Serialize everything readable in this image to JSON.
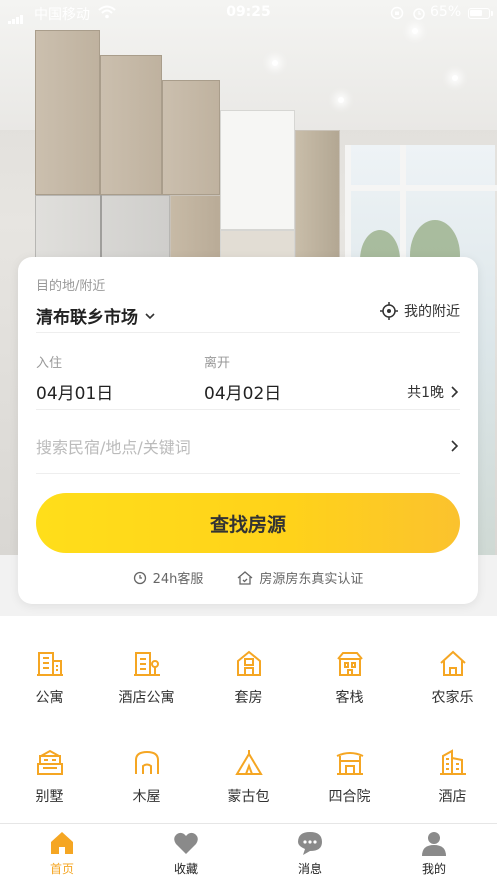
{
  "status_bar": {
    "carrier": "中国移动",
    "time": "09:25",
    "battery": "65%"
  },
  "search": {
    "dest_label": "目的地/附近",
    "dest_value": "清布联乡市场",
    "nearby_label": "我的附近",
    "checkin_label": "入住",
    "checkin_value": "04月01日",
    "checkout_label": "离开",
    "checkout_value": "04月02日",
    "nights": "共1晚",
    "keyword_placeholder": "搜索民宿/地点/关键词",
    "submit_label": "查找房源",
    "service_label": "24h客服",
    "verify_label": "房源房东真实认证"
  },
  "categories": [
    {
      "label": "公寓",
      "icon": "apartment-icon"
    },
    {
      "label": "酒店公寓",
      "icon": "hotel-apartment-icon"
    },
    {
      "label": "套房",
      "icon": "suite-icon"
    },
    {
      "label": "客栈",
      "icon": "inn-icon"
    },
    {
      "label": "农家乐",
      "icon": "farmhouse-icon"
    },
    {
      "label": "别墅",
      "icon": "villa-icon"
    },
    {
      "label": "木屋",
      "icon": "cabin-icon"
    },
    {
      "label": "蒙古包",
      "icon": "yurt-icon"
    },
    {
      "label": "四合院",
      "icon": "courtyard-icon"
    },
    {
      "label": "酒店",
      "icon": "hotel-icon"
    }
  ],
  "tabs": [
    {
      "label": "首页",
      "icon": "home-icon",
      "active": true
    },
    {
      "label": "收藏",
      "icon": "heart-icon",
      "active": false
    },
    {
      "label": "消息",
      "icon": "message-icon",
      "active": false
    },
    {
      "label": "我的",
      "icon": "user-icon",
      "active": false
    }
  ],
  "colors": {
    "accent": "#f5a623",
    "button": "#ffd71a"
  }
}
